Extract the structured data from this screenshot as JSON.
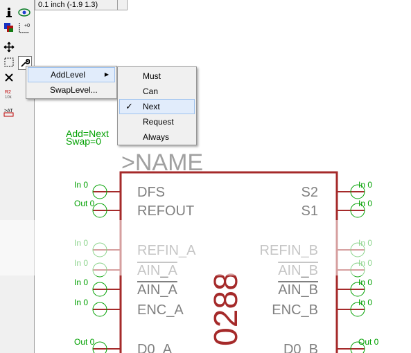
{
  "coordinates": {
    "readout": "0.1 inch (-1.9 1.3)"
  },
  "toolbar": {
    "tools": [
      {
        "icon": "info-icon"
      },
      {
        "icon": "eye-icon"
      },
      {
        "icon": "layers-icon"
      },
      {
        "icon": "mark-icon",
        "glyph": "+0"
      },
      {
        "icon": "move-icon"
      },
      {
        "icon": "group-select-icon"
      },
      {
        "icon": "wrench-icon"
      },
      {
        "icon": "delete-icon"
      },
      {
        "icon": "name-icon",
        "glyph": "R2 10k"
      },
      {
        "icon": "attribute-icon",
        "glyph": ">AT"
      }
    ]
  },
  "context_menu": {
    "items": [
      "AddLevel",
      "SwapLevel..."
    ],
    "submenu_arrow": "▶"
  },
  "submenu": {
    "items": [
      "Must",
      "Can",
      "Next",
      "Request",
      "Always"
    ],
    "checked": "Next",
    "check_mark": "✓"
  },
  "schematic": {
    "gate_info": {
      "add": "Add=Next",
      "swap": "Swap=0"
    },
    "name_text": ">NAME",
    "part_value": "0288",
    "left_pins": [
      {
        "name": "DFS",
        "label": "In 0"
      },
      {
        "name": "REFOUT",
        "label": "Out 0"
      },
      {
        "name": "REFIN_A",
        "label": "In 0"
      },
      {
        "name": "AIN_A",
        "label": "In 0"
      },
      {
        "name": "AIN_A",
        "label": "In 0"
      },
      {
        "name": "ENC_A",
        "label": "In 0"
      },
      {
        "name": "D0_A",
        "label": "Out 0"
      }
    ],
    "right_pins": [
      {
        "name": "S2",
        "label": "In 0"
      },
      {
        "name": "S1",
        "label": "In 0"
      },
      {
        "name": "REFIN_B",
        "label": "In 0"
      },
      {
        "name": "AIN_B",
        "label": "In 0"
      },
      {
        "name": "AIN_B",
        "label": "In 0"
      },
      {
        "name": "ENC_B",
        "label": "In 0"
      },
      {
        "name": "D0_B",
        "label": "Out 0"
      }
    ]
  },
  "colors": {
    "symbol_outline": "#a52a2a",
    "pin_text": "#808080",
    "pin_circle": "#00a000",
    "menu_highlight": "#e1ecfb"
  }
}
